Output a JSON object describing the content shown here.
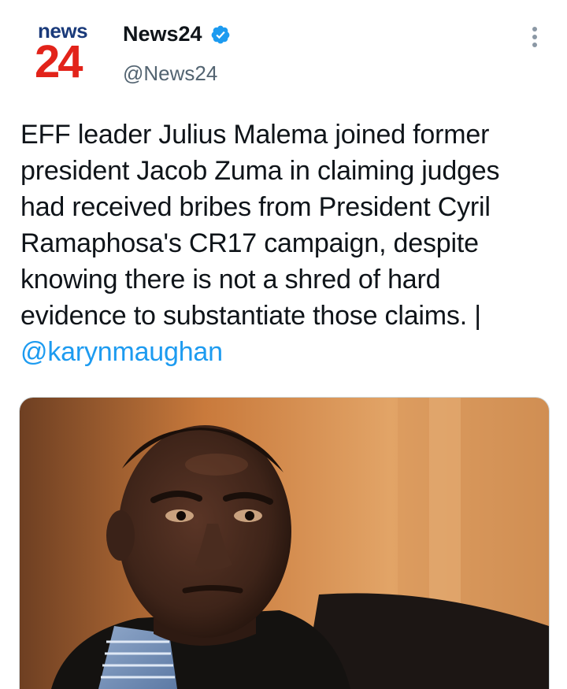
{
  "account": {
    "logo_top": "news",
    "logo_bottom": "24",
    "display_name": "News24",
    "handle": "@News24",
    "verified": true,
    "verified_icon": "verified-badge-icon",
    "more_icon": "more-vertical-icon"
  },
  "tweet": {
    "text": "EFF leader Julius Malema joined former president Jacob Zuma in claiming judges had received bribes from President Cyril Ramaphosa's CR17 campaign, despite knowing there is not a shred of hard evidence to substantiate those claims. | ",
    "mention": "@karynmaughan"
  },
  "media": {
    "type": "photo"
  },
  "colors": {
    "link": "#1d9bf0",
    "verified": "#1d9bf0",
    "logo_red": "#e2231a",
    "logo_navy": "#1a3a7a",
    "secondary_text": "#536471"
  }
}
